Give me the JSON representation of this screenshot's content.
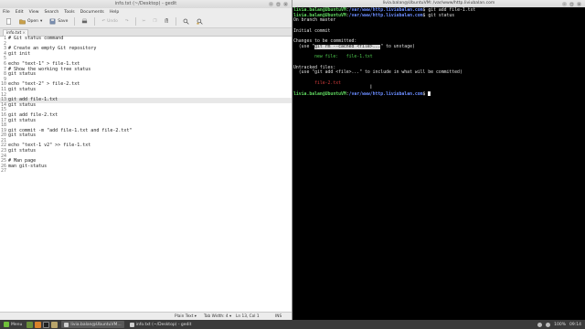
{
  "editor": {
    "window_title": "info.txt (~/Desktop) - gedit",
    "menu": [
      "File",
      "Edit",
      "View",
      "Search",
      "Tools",
      "Documents",
      "Help"
    ],
    "toolbar": {
      "open": "Open",
      "save": "Save",
      "undo": "Undo",
      "redo": "Redo"
    },
    "tab_name": "info.txt",
    "current_line": 13,
    "lines": [
      {
        "n": "1",
        "t": "# Git status command"
      },
      {
        "n": "2",
        "t": ""
      },
      {
        "n": "3",
        "t": "# Create an empty Git repository"
      },
      {
        "n": "4",
        "t": "git init"
      },
      {
        "n": "5",
        "t": ""
      },
      {
        "n": "6",
        "t": "echo \"text-1\" > file-1.txt"
      },
      {
        "n": "7",
        "t": "# Show the working tree status"
      },
      {
        "n": "8",
        "t": "git status"
      },
      {
        "n": "9",
        "t": ""
      },
      {
        "n": "10",
        "t": "echo \"text-2\" > file-2.txt"
      },
      {
        "n": "11",
        "t": "git status"
      },
      {
        "n": "12",
        "t": ""
      },
      {
        "n": "13",
        "t": "git add file-1.txt"
      },
      {
        "n": "14",
        "t": "git status"
      },
      {
        "n": "15",
        "t": ""
      },
      {
        "n": "16",
        "t": "git add file-2.txt"
      },
      {
        "n": "17",
        "t": "git status"
      },
      {
        "n": "18",
        "t": ""
      },
      {
        "n": "19",
        "t": "git commit -m \"add file-1.txt and file-2.txt\""
      },
      {
        "n": "20",
        "t": "git status"
      },
      {
        "n": "21",
        "t": ""
      },
      {
        "n": "22",
        "t": "echo \"text-1 v2\" >> file-1.txt"
      },
      {
        "n": "23",
        "t": "git status"
      },
      {
        "n": "24",
        "t": ""
      },
      {
        "n": "25",
        "t": "# Man page"
      },
      {
        "n": "26",
        "t": "man git-status"
      },
      {
        "n": "27",
        "t": ""
      }
    ],
    "status": {
      "syntax": "Plain Text ▾",
      "tab_width": "Tab Width: 4 ▾",
      "position": "Ln 13, Col 1",
      "mode": "INS"
    }
  },
  "terminal": {
    "window_title": "livia.balan@UbuntuVM: /var/www/http.liviubalan.com",
    "prompt_user": "livia.balan@UbuntuVM",
    "prompt_path": "/var/www/http.liviubalan.com",
    "cmd1": "git add file-1.txt",
    "cmd2": "git status",
    "out_branch": "On branch master",
    "out_initial": "Initial commit",
    "out_changes": "Changes to be committed:",
    "out_hint1_pre": "  (use \"",
    "out_hint1_sel": "git rm --cached <file>...",
    "out_hint1_post": "\" to unstage)",
    "out_newfile": "        new file:   file-1.txt",
    "out_untracked": "Untracked files:",
    "out_hint2": "  (use \"git add <file>...\" to include in what will be committed)",
    "out_untracked_file": "        file-2.txt"
  },
  "panel": {
    "menu_label": "Menu",
    "task_terminal": "livia.balan@UbuntuVM...",
    "task_editor": "info.txt (~/Desktop) - gedit",
    "clock": "09:14",
    "battery": "100%"
  }
}
